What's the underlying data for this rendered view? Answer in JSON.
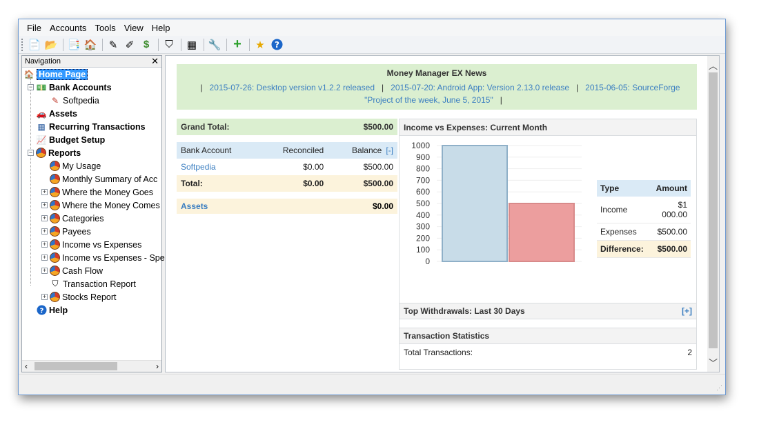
{
  "menu": [
    "File",
    "Accounts",
    "Tools",
    "View",
    "Help"
  ],
  "navigation": {
    "title": "Navigation",
    "items": [
      {
        "label": "Home Page"
      },
      {
        "label": "Bank Accounts"
      },
      {
        "label": "Softpedia"
      },
      {
        "label": "Assets"
      },
      {
        "label": "Recurring Transactions"
      },
      {
        "label": "Budget Setup"
      },
      {
        "label": "Reports"
      },
      {
        "label": "My Usage"
      },
      {
        "label": "Monthly Summary of Acc"
      },
      {
        "label": "Where the Money Goes"
      },
      {
        "label": "Where the Money Comes"
      },
      {
        "label": "Categories"
      },
      {
        "label": "Payees"
      },
      {
        "label": "Income vs Expenses"
      },
      {
        "label": "Income vs Expenses - Spe"
      },
      {
        "label": "Cash Flow"
      },
      {
        "label": "Transaction Report"
      },
      {
        "label": "Stocks Report"
      },
      {
        "label": "Help"
      }
    ]
  },
  "news": {
    "title": "Money Manager EX News",
    "items": [
      "2015-07-26: Desktop version v1.2.2 released",
      "2015-07-20: Android App: Version 2.13.0 release",
      "2015-06-05: SourceForge",
      "\"Project of the week, June 5, 2015\""
    ]
  },
  "summary": {
    "grand_total_label": "Grand Total:",
    "grand_total": "$500.00",
    "col_account": "Bank Account",
    "col_reconciled": "Reconciled",
    "col_balance": "Balance",
    "collapse": "[-]",
    "account_name": "Softpedia",
    "account_reconciled": "$0.00",
    "account_balance": "$500.00",
    "total_label": "Total:",
    "total_reconciled": "$0.00",
    "total_balance": "$500.00",
    "assets_label": "Assets",
    "assets_value": "$0.00"
  },
  "income_expenses": {
    "title": "Income vs Expenses: Current Month",
    "col_type": "Type",
    "col_amount": "Amount",
    "income_label": "Income",
    "income_value": "$1 000.00",
    "expenses_label": "Expenses",
    "expenses_value": "$500.00",
    "difference_label": "Difference:",
    "difference_value": "$500.00"
  },
  "chart_data": {
    "type": "bar",
    "categories": [
      "Income",
      "Expenses"
    ],
    "values": [
      1000,
      500
    ],
    "colors": [
      "#c8dce8",
      "#ec9e9e"
    ],
    "ylim": [
      0,
      1000
    ],
    "yticks": [
      0,
      100,
      200,
      300,
      400,
      500,
      600,
      700,
      800,
      900,
      1000
    ],
    "grid": true
  },
  "withdrawals": {
    "title": "Top Withdrawals: Last 30 Days",
    "expand": "[+]"
  },
  "stats": {
    "title": "Transaction Statistics",
    "total_label": "Total Transactions:",
    "total_value": "2"
  }
}
